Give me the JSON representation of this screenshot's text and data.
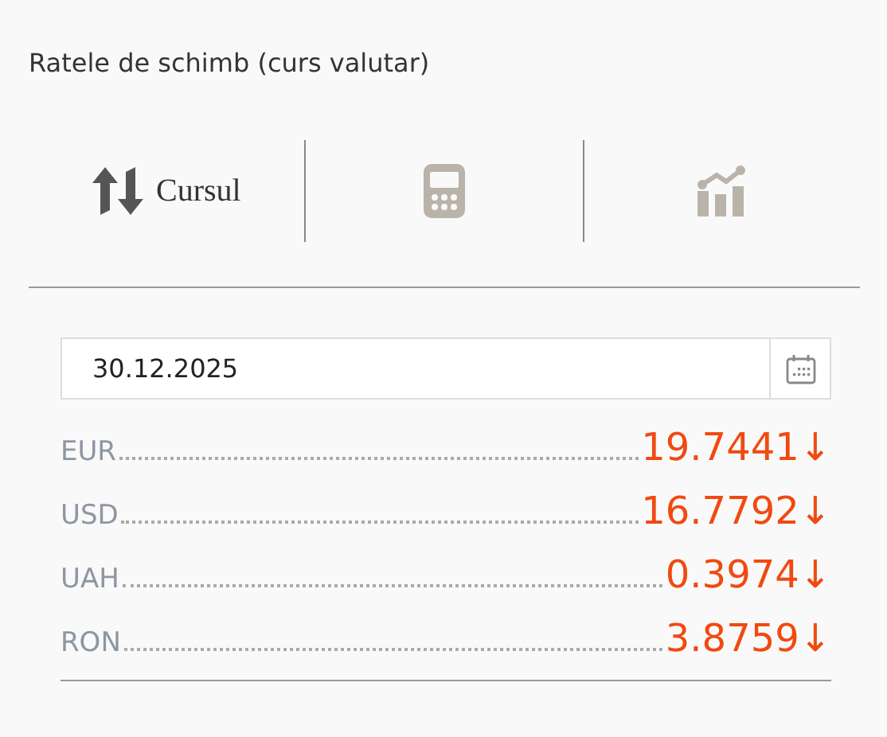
{
  "title": "Ratele de schimb (curs valutar)",
  "tabs": [
    {
      "kind": "exchange",
      "label": "Cursul",
      "selected": true
    },
    {
      "kind": "calculator",
      "selected": false
    },
    {
      "kind": "chart",
      "selected": false
    }
  ],
  "date_field": {
    "value": "30.12.2025"
  },
  "rates": [
    {
      "currency": "EUR",
      "value": "19.7441",
      "trend": "↓"
    },
    {
      "currency": "USD",
      "value": "16.7792",
      "trend": "↓"
    },
    {
      "currency": "UAH",
      "value": "0.3974",
      "trend": "↓"
    },
    {
      "currency": "RON",
      "value": "3.8759",
      "trend": "↓"
    }
  ]
}
